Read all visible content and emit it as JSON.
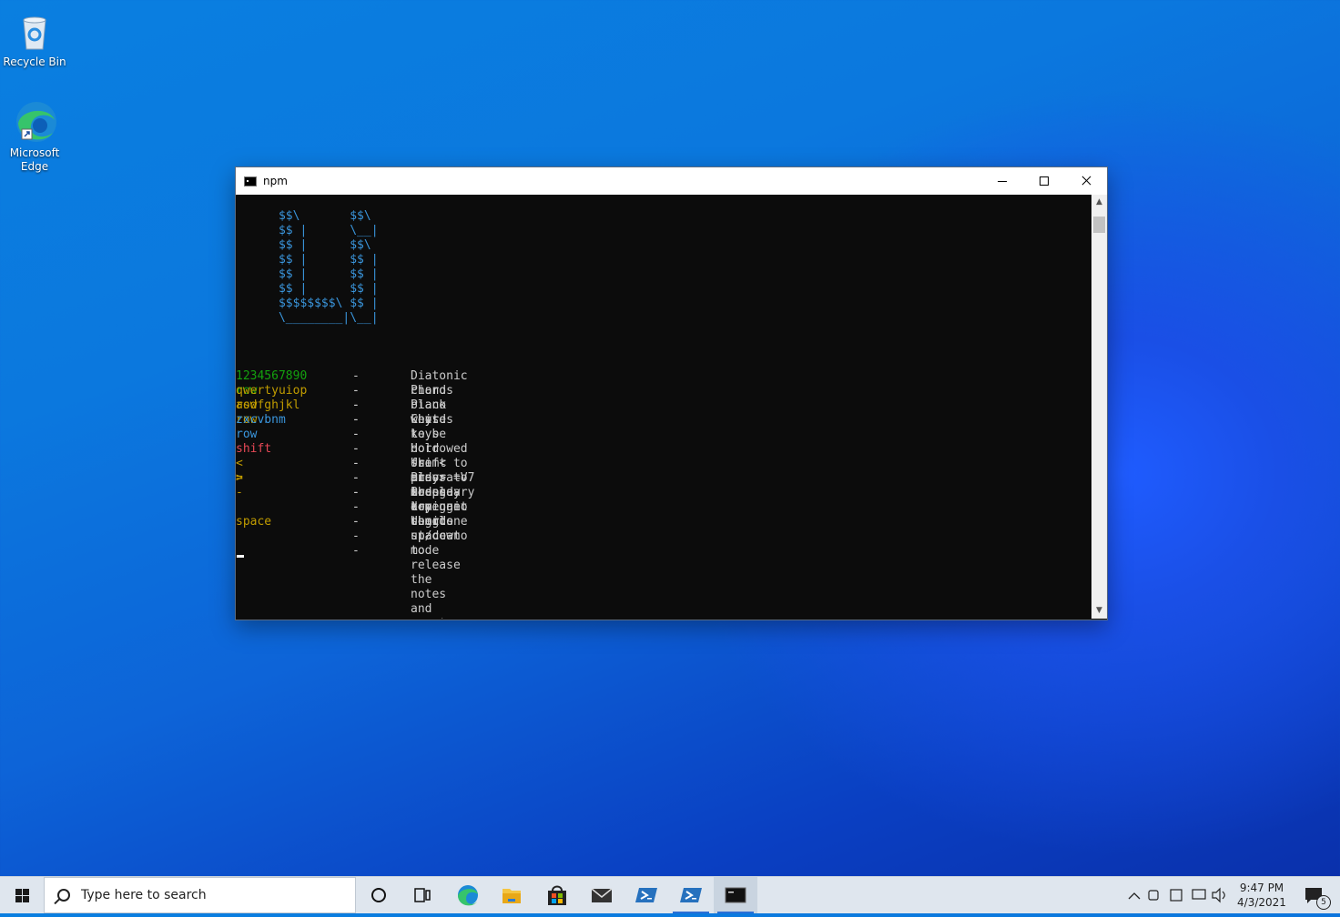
{
  "desktop": {
    "icons": [
      {
        "label": "Recycle Bin"
      },
      {
        "label": "Microsoft Edge"
      }
    ]
  },
  "window": {
    "title": "npm"
  },
  "console": {
    "ascii_art": "      $$\\       $$\\\n      $$ |      \\__|\n      $$ |      $$\\\n      $$ |      $$ |\n      $$ |      $$ |\n      $$ |      $$ |\n      $$$$$$$$\\ $$ |\n      \\________|\\__|",
    "help_rows": [
      {
        "key": "1234567890 row",
        "sep": "---",
        "text": "Diatonic chords"
      },
      {
        "key": "qwertyuiop row",
        "sep": "---",
        "text": "Piano black keys"
      },
      {
        "key": "asdfghjkl row",
        "sep": "---",
        "text": "Piano white keys"
      },
      {
        "key": "zxcvbnm row",
        "sep": "---",
        "text": "Chords to be borrowed from minor mode"
      },
      {
        "key": "shift",
        "sep": "---",
        "text": "Hold shift to play a V7 secondary dominant chord"
      },
      {
        "key": "< >",
        "sep": "---",
        "text": "Use < and > to change key one semitone up/down"
      },
      {
        "key": "=",
        "sep": "---",
        "text": "Press = to play arpeggio chords"
      },
      {
        "key": "-",
        "sep": "---",
        "text": "Press - to toggle staccato mode"
      },
      {
        "key": "space",
        "sep": "---",
        "text": "Use space to release the notes and reset"
      }
    ]
  },
  "taskbar": {
    "search_placeholder": "Type here to search",
    "clock_time": "9:47 PM",
    "clock_date": "4/3/2021",
    "notification_count": "5"
  }
}
